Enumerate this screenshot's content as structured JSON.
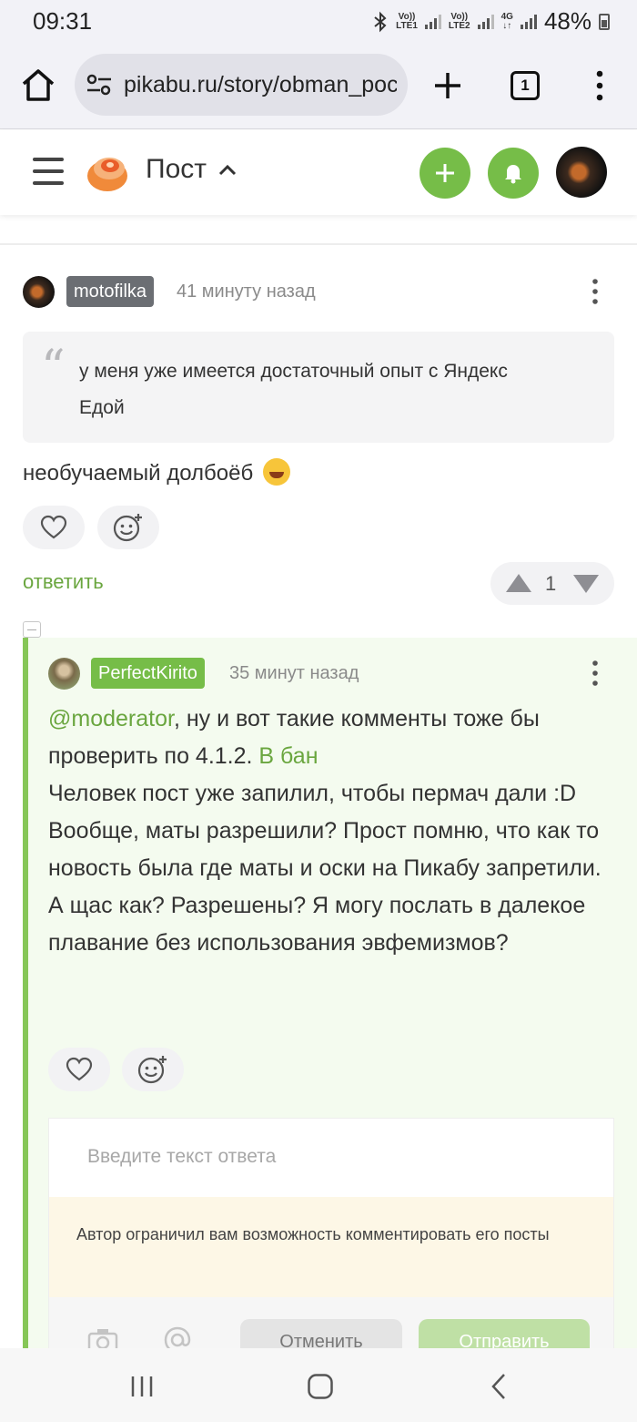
{
  "status_bar": {
    "time": "09:31",
    "sim1": {
      "top": "Vo))",
      "bottom": "LTE1"
    },
    "sim2": {
      "top": "Vo))",
      "bottom": "LTE2"
    },
    "network": "4G",
    "battery": "48%"
  },
  "browser": {
    "url": "pikabu.ru/story/obman_poc",
    "tab_count": "1"
  },
  "header": {
    "title": "Пост"
  },
  "comment1": {
    "username": "motofilka",
    "time": "41 минуту назад",
    "quote": "у меня уже имеется достаточный опыт с Яндекс Едой",
    "text": "необучаемый долбоёб",
    "reply_label": "ответить",
    "rating": "1"
  },
  "comment2": {
    "username": "PerfectKirito",
    "time": "35 минут назад",
    "mention": "@moderator",
    "text_part1": ", ну и вот такие комменты тоже бы проверить по 4.1.2. ",
    "ban_link": "В бан",
    "text_part2": "Человек пост уже запилил, чтобы пермач дали :D",
    "text_part3": "Вообще, маты разрешили? Прост помню, что как то новость была где маты и оски на Пикабу запретили. А щас как? Разрешены? Я могу послать в далекое плавание без использования эвфемизмов?"
  },
  "reply_box": {
    "placeholder": "Введите текст ответа",
    "restriction": "Автор ограничил вам возможность комментировать его посты",
    "cancel": "Отменить",
    "send": "Отправить"
  },
  "colors": {
    "accent_green": "#76bd48",
    "link_green": "#6aa63f",
    "badge_gray": "#6b6e73"
  }
}
